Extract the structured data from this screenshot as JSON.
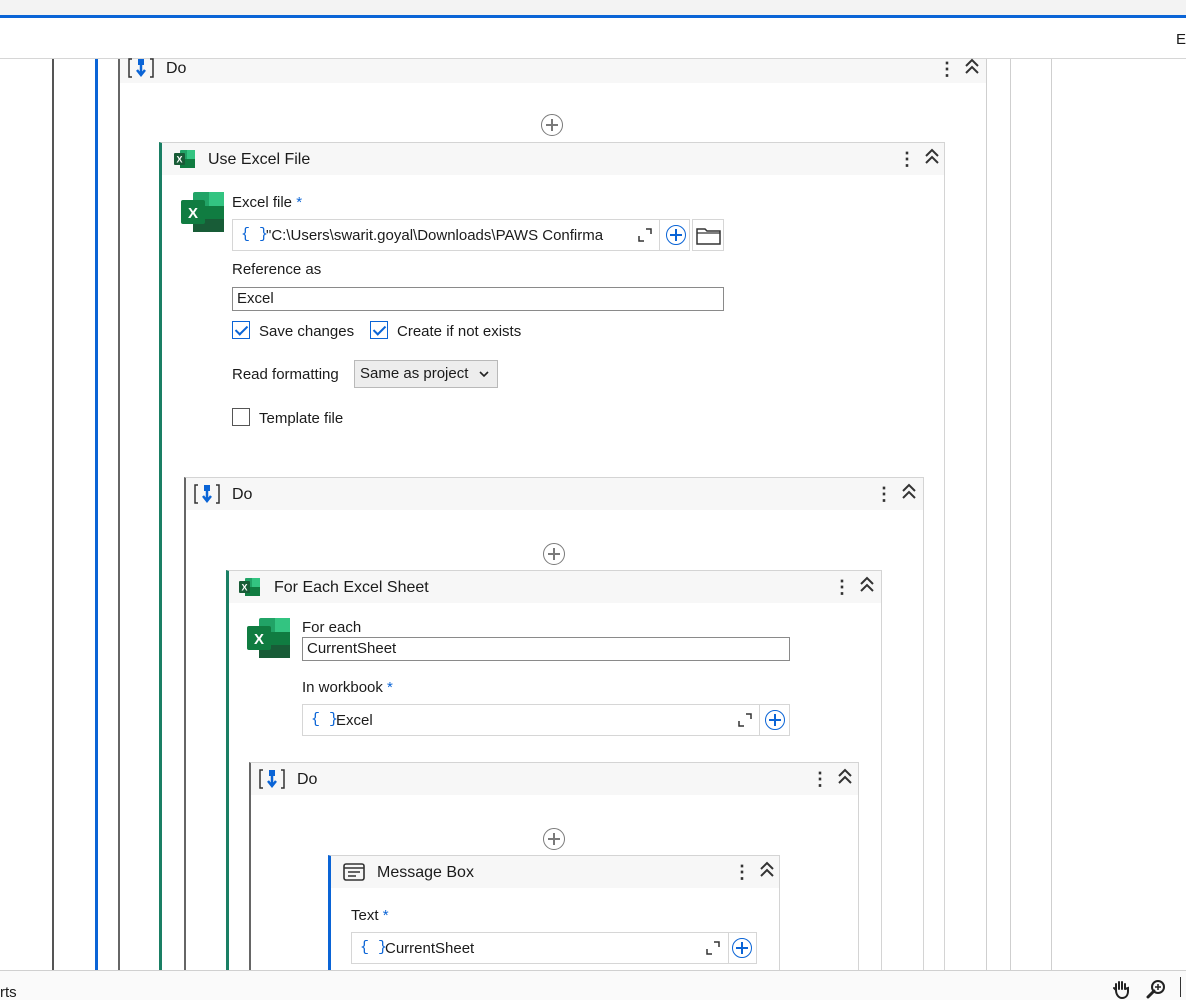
{
  "toolbar": {
    "edge_text": "E"
  },
  "status": {
    "left_text": "rts",
    "hand_icon": "hand-icon",
    "zoom_icon": "zoom-icon"
  },
  "do_outer": {
    "title": "Do"
  },
  "use_excel": {
    "title": "Use Excel File",
    "excel_file_label": "Excel file",
    "required_mark": "*",
    "excel_file_value": "\"C:\\Users\\swarit.goyal\\Downloads\\PAWS Confirma",
    "reference_label": "Reference as",
    "reference_value": "Excel",
    "save_changes_label": "Save changes",
    "save_changes_checked": true,
    "create_label": "Create if not exists",
    "create_checked": true,
    "read_formatting_label": "Read formatting",
    "read_formatting_value": "Same as project",
    "template_label": "Template file",
    "template_checked": false
  },
  "do_mid": {
    "title": "Do"
  },
  "for_each": {
    "title": "For Each Excel Sheet",
    "for_each_label": "For each",
    "for_each_value": "CurrentSheet",
    "in_workbook_label": "In workbook",
    "required_mark": "*",
    "in_workbook_value": "Excel"
  },
  "do_inner": {
    "title": "Do"
  },
  "message_box": {
    "title": "Message Box",
    "text_label": "Text",
    "required_mark": "*",
    "text_value": "CurrentSheet"
  },
  "colors": {
    "accent": "#0a64d6",
    "excel_green": "#107c41",
    "left_bar_green": "#1a7f64"
  }
}
